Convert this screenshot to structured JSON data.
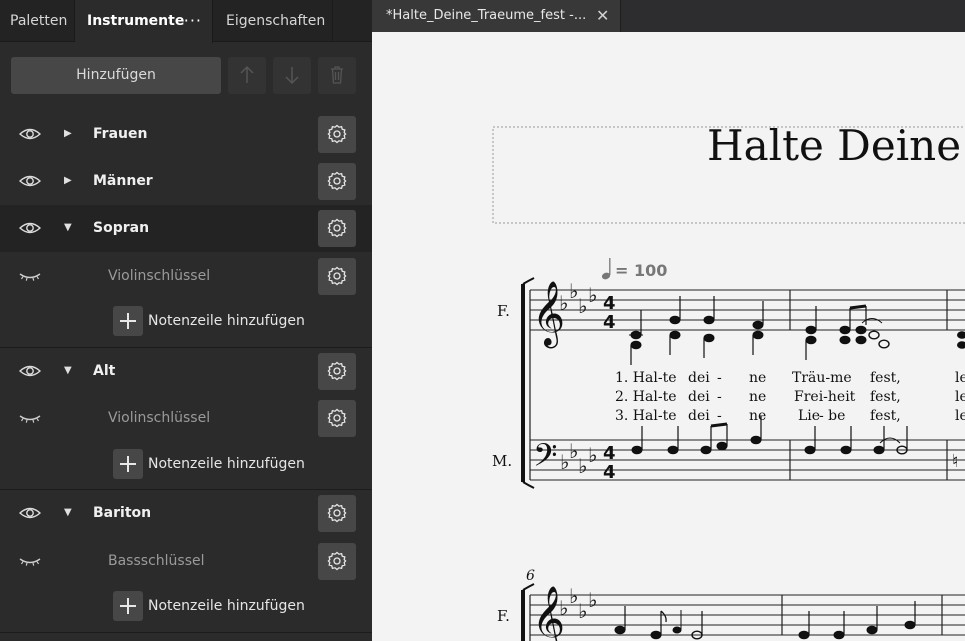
{
  "panel": {
    "tabs": {
      "palettes": "Paletten",
      "instruments": "Instrumente",
      "more": "···",
      "properties": "Eigenschaften"
    },
    "toolbar": {
      "add_label": "Hinzufügen",
      "up_icon": "arrow-up-icon",
      "down_icon": "arrow-down-icon",
      "delete_icon": "trash-icon"
    },
    "rows": [
      {
        "type": "instrument",
        "name": "Frauen",
        "expanded": false,
        "visible": true
      },
      {
        "type": "instrument",
        "name": "Männer",
        "expanded": false,
        "visible": true
      },
      {
        "type": "instrument",
        "name": "Sopran",
        "expanded": true,
        "visible": true,
        "selected": true
      },
      {
        "type": "staff",
        "name": "Violinschlüssel",
        "visible": false
      },
      {
        "type": "add",
        "label": "Notenzeile hinzufügen"
      },
      {
        "type": "instrument",
        "name": "Alt",
        "expanded": true,
        "visible": true
      },
      {
        "type": "staff",
        "name": "Violinschlüssel",
        "visible": false
      },
      {
        "type": "add",
        "label": "Notenzeile hinzufügen"
      },
      {
        "type": "instrument",
        "name": "Bariton",
        "expanded": true,
        "visible": true
      },
      {
        "type": "staff",
        "name": "Bassschlüssel",
        "visible": false
      },
      {
        "type": "add",
        "label": "Notenzeile hinzufügen"
      }
    ]
  },
  "score": {
    "tab_title": "*Halte_Deine_Traeume_fest -...",
    "close_glyph": "✕",
    "title": "Halte Deine T",
    "tempo": "= 100",
    "staff_label_1": "F.",
    "staff_label_2": "M.",
    "system2_measure": "6",
    "system2_label": "F.",
    "lyrics": [
      [
        "1. Hal-te",
        "dei",
        "-",
        "ne",
        "Träu-me",
        "fest,",
        "le"
      ],
      [
        "2. Hal-te",
        "dei",
        "-",
        "ne",
        "Frei-heit",
        "fest,",
        "le"
      ],
      [
        "3. Hal-te",
        "dei",
        "-",
        "ne",
        "Lie",
        "- be",
        "fest,",
        "le"
      ]
    ]
  }
}
